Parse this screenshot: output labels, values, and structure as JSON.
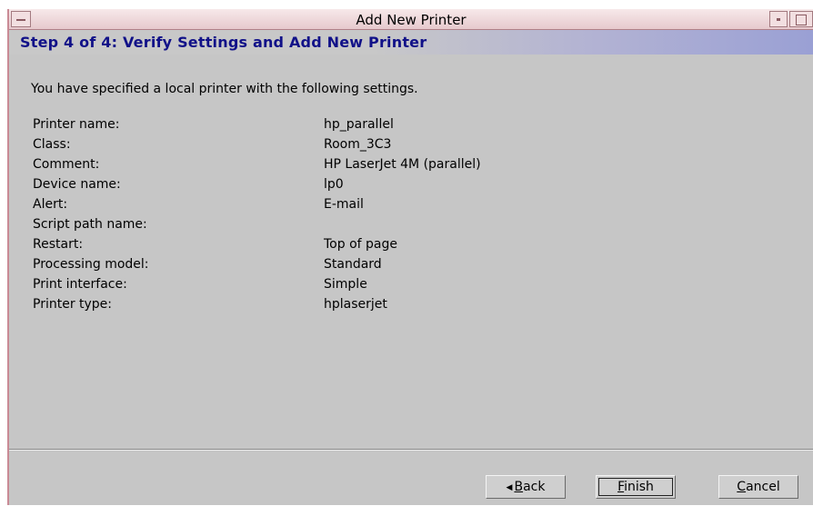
{
  "window": {
    "title": "Add New Printer"
  },
  "wizard": {
    "step_title": "Step 4 of 4: Verify Settings and Add New Printer",
    "intro": "You have specified a local printer with the following settings."
  },
  "settings": [
    {
      "label": "Printer name:",
      "value": "hp_parallel"
    },
    {
      "label": "Class:",
      "value": "Room_3C3"
    },
    {
      "label": "Comment:",
      "value": "HP LaserJet 4M (parallel)"
    },
    {
      "label": "Device name:",
      "value": "lp0"
    },
    {
      "label": "Alert:",
      "value": "E-mail"
    },
    {
      "label": "Script path name:",
      "value": ""
    },
    {
      "label": "Restart:",
      "value": "Top of page"
    },
    {
      "label": "Processing model:",
      "value": "Standard"
    },
    {
      "label": "Print interface:",
      "value": "Simple"
    },
    {
      "label": "Printer type:",
      "value": "hplaserjet"
    }
  ],
  "buttons": {
    "back_mnemonic": "B",
    "back_rest": "ack",
    "finish_mnemonic": "F",
    "finish_rest": "inish",
    "cancel_mnemonic": "C",
    "cancel_rest": "ancel"
  },
  "icons": {
    "window_menu": "window-menu-icon",
    "minimize": "minimize-icon",
    "maximize": "maximize-icon",
    "back_arrow": "left-arrow-icon"
  },
  "colors": {
    "step_title": "#111188",
    "window_bg": "#c6c6c6",
    "titlebar": "#e6c9cd"
  }
}
